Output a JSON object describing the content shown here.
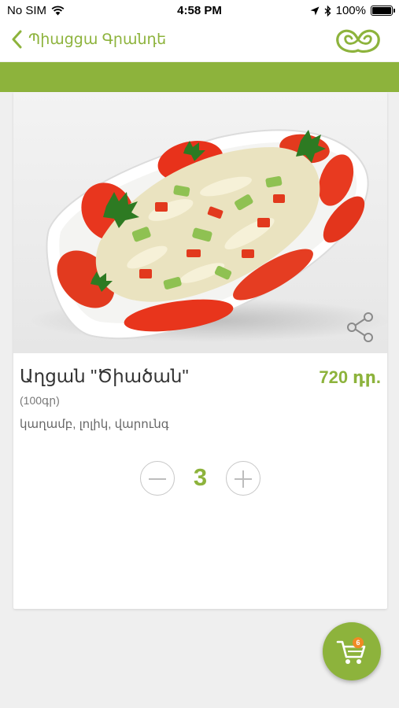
{
  "status_bar": {
    "carrier": "No SIM",
    "time": "4:58 PM",
    "battery_text": "100%",
    "battery_level": 1.0
  },
  "nav": {
    "back_label": "Պիացցա Գրանդե",
    "logo_icon": "brand-logo-icon"
  },
  "product": {
    "title": "Աղցան \"Ծիածան\"",
    "price": "720 դր.",
    "weight": "(100գր)",
    "ingredients": "կաղամբ, լոլիկ, վարունգ",
    "photo": "salad-photo",
    "share_icon": "share-icon"
  },
  "quantity": {
    "value": "3",
    "minus_icon": "minus-icon",
    "plus_icon": "plus-icon"
  },
  "cart": {
    "badge_count": "6",
    "icon": "cart-icon"
  },
  "colors": {
    "accent": "#8db33c",
    "badge": "#f08a24",
    "background": "#efefef"
  }
}
